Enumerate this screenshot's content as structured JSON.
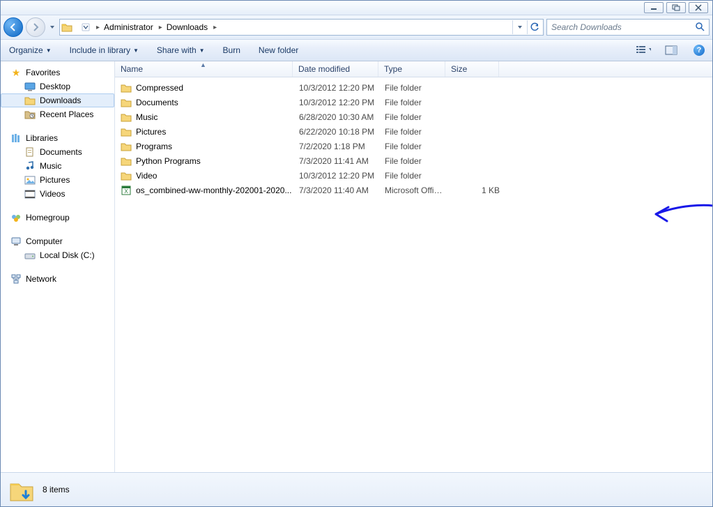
{
  "window_controls": {
    "minimize": "minimize",
    "maximize": "maximize",
    "close": "close"
  },
  "breadcrumbs": [
    "Administrator",
    "Downloads"
  ],
  "search": {
    "placeholder": "Search Downloads"
  },
  "toolbar": {
    "organize": "Organize",
    "include": "Include in library",
    "share": "Share with",
    "burn": "Burn",
    "newfolder": "New folder"
  },
  "nav": {
    "favorites": {
      "label": "Favorites",
      "items": [
        "Desktop",
        "Downloads",
        "Recent Places"
      ],
      "selected": 1
    },
    "libraries": {
      "label": "Libraries",
      "items": [
        "Documents",
        "Music",
        "Pictures",
        "Videos"
      ]
    },
    "homegroup": {
      "label": "Homegroup"
    },
    "computer": {
      "label": "Computer",
      "items": [
        "Local Disk (C:)"
      ]
    },
    "network": {
      "label": "Network"
    }
  },
  "columns": {
    "name": "Name",
    "date": "Date modified",
    "type": "Type",
    "size": "Size"
  },
  "files": [
    {
      "name": "Compressed",
      "date": "10/3/2012 12:20 PM",
      "type": "File folder",
      "size": "",
      "kind": "folder"
    },
    {
      "name": "Documents",
      "date": "10/3/2012 12:20 PM",
      "type": "File folder",
      "size": "",
      "kind": "folder"
    },
    {
      "name": "Music",
      "date": "6/28/2020 10:30 AM",
      "type": "File folder",
      "size": "",
      "kind": "folder"
    },
    {
      "name": "Pictures",
      "date": "6/22/2020 10:18 PM",
      "type": "File folder",
      "size": "",
      "kind": "folder"
    },
    {
      "name": "Programs",
      "date": "7/2/2020 1:18 PM",
      "type": "File folder",
      "size": "",
      "kind": "folder"
    },
    {
      "name": "Python Programs",
      "date": "7/3/2020 11:41 AM",
      "type": "File folder",
      "size": "",
      "kind": "folder"
    },
    {
      "name": "Video",
      "date": "10/3/2012 12:20 PM",
      "type": "File folder",
      "size": "",
      "kind": "folder"
    },
    {
      "name": "os_combined-ww-monthly-202001-2020...",
      "date": "7/3/2020 11:40 AM",
      "type": "Microsoft Office E...",
      "size": "1 KB",
      "kind": "excel"
    }
  ],
  "status": {
    "count_label": "8 items"
  }
}
